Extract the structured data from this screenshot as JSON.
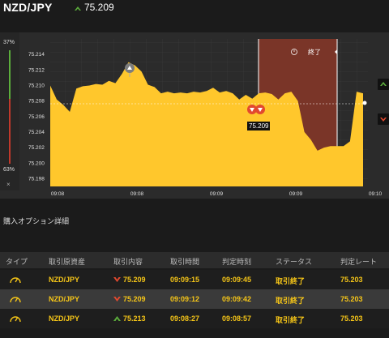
{
  "header": {
    "pair": "NZD/JPY",
    "rate": "75.209"
  },
  "left_panel": {
    "up_percent": "37%",
    "down_percent": "63%",
    "close_symbol": "×"
  },
  "chart_data": {
    "type": "area",
    "y_ticks": [
      "75.214",
      "75.212",
      "75.210",
      "75.208",
      "75.206",
      "75.204",
      "75.202",
      "75.200",
      "75.198"
    ],
    "x_ticks": [
      "09:08",
      "09:08",
      "09:09",
      "09:09",
      "09:10"
    ],
    "ylim": [
      75.197,
      75.216
    ],
    "current_rate_label": "75.209",
    "end_label": "終了",
    "series": [
      {
        "values": [
          75.21,
          75.2082,
          75.2075,
          75.2066,
          75.2096,
          75.2099,
          75.21,
          75.2102,
          75.2101,
          75.2106,
          75.2103,
          75.2115,
          75.213,
          75.2126,
          75.2118,
          75.2101,
          75.2098,
          75.209,
          75.2092,
          75.209,
          75.2091,
          75.209,
          75.2092,
          75.2091,
          75.2093,
          75.2097,
          75.2091,
          75.2093,
          75.209,
          75.2082,
          75.2088,
          75.2083,
          75.209,
          75.2091,
          75.2089,
          75.2082,
          75.209,
          75.2092,
          75.208,
          75.204,
          75.203,
          75.2016,
          75.202,
          75.2022,
          75.2022,
          75.2022,
          75.2028,
          75.2092,
          75.209
        ]
      }
    ]
  },
  "section": {
    "title": "購入オプション詳細"
  },
  "table": {
    "headers": [
      "タイプ",
      "取引原資産",
      "取引内容",
      "取引時間",
      "判定時刻",
      "ステータス",
      "判定レート"
    ],
    "rows": [
      {
        "asset": "NZD/JPY",
        "direction": "down",
        "content": "75.209",
        "time": "09:09:15",
        "judge": "09:09:45",
        "status": "取引終了",
        "rate": "75.203"
      },
      {
        "asset": "NZD/JPY",
        "direction": "down",
        "content": "75.209",
        "time": "09:09:12",
        "judge": "09:09:42",
        "status": "取引終了",
        "rate": "75.203"
      },
      {
        "asset": "NZD/JPY",
        "direction": "up",
        "content": "75.213",
        "time": "09:08:27",
        "judge": "09:08:57",
        "status": "取引終了",
        "rate": "75.203"
      }
    ]
  },
  "colors": {
    "area": "#ffc72c",
    "up": "#5cae3c",
    "down": "#e2492f",
    "end_zone": "#7a3528"
  }
}
